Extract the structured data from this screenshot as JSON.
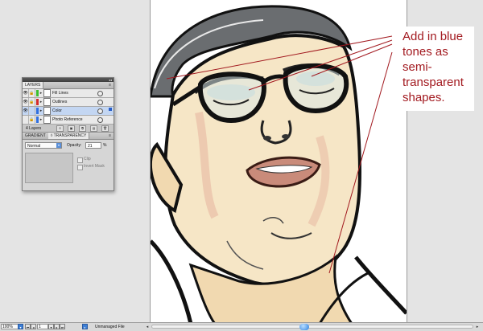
{
  "annotation": {
    "text": "Add in blue tones as semi-transparent shapes.",
    "color": "#a2191f"
  },
  "layers_panel": {
    "tab_label": "LAYERS",
    "layers": [
      {
        "name": "Fill Lines",
        "color": "#3bbf2e",
        "visible": true,
        "locked": true,
        "selected": false
      },
      {
        "name": "Outlines",
        "color": "#d42a2a",
        "visible": true,
        "locked": true,
        "selected": false
      },
      {
        "name": "Color",
        "color": "#2f6fe0",
        "visible": true,
        "locked": false,
        "selected": true
      },
      {
        "name": "Photo Reference",
        "color": "#2f6fe0",
        "visible": false,
        "locked": true,
        "selected": false
      }
    ],
    "count_label": "4 Layers"
  },
  "transparency_panel": {
    "tabs": [
      "GRADIENT",
      "◊ TRANSPARENCY"
    ],
    "blend_mode": "Normal",
    "opacity_label": "Opacity:",
    "opacity_value": "21",
    "opacity_unit": "%",
    "clip_label": "Clip",
    "invert_mask_label": "Invert Mask"
  },
  "status_bar": {
    "zoom": "100%",
    "artboard_number": "1",
    "status": "Unmanaged File"
  },
  "colors": {
    "accent_blue": "#3d7fd6",
    "selection_blue": "#c3d6f2",
    "annotation_red": "#a2191f"
  }
}
